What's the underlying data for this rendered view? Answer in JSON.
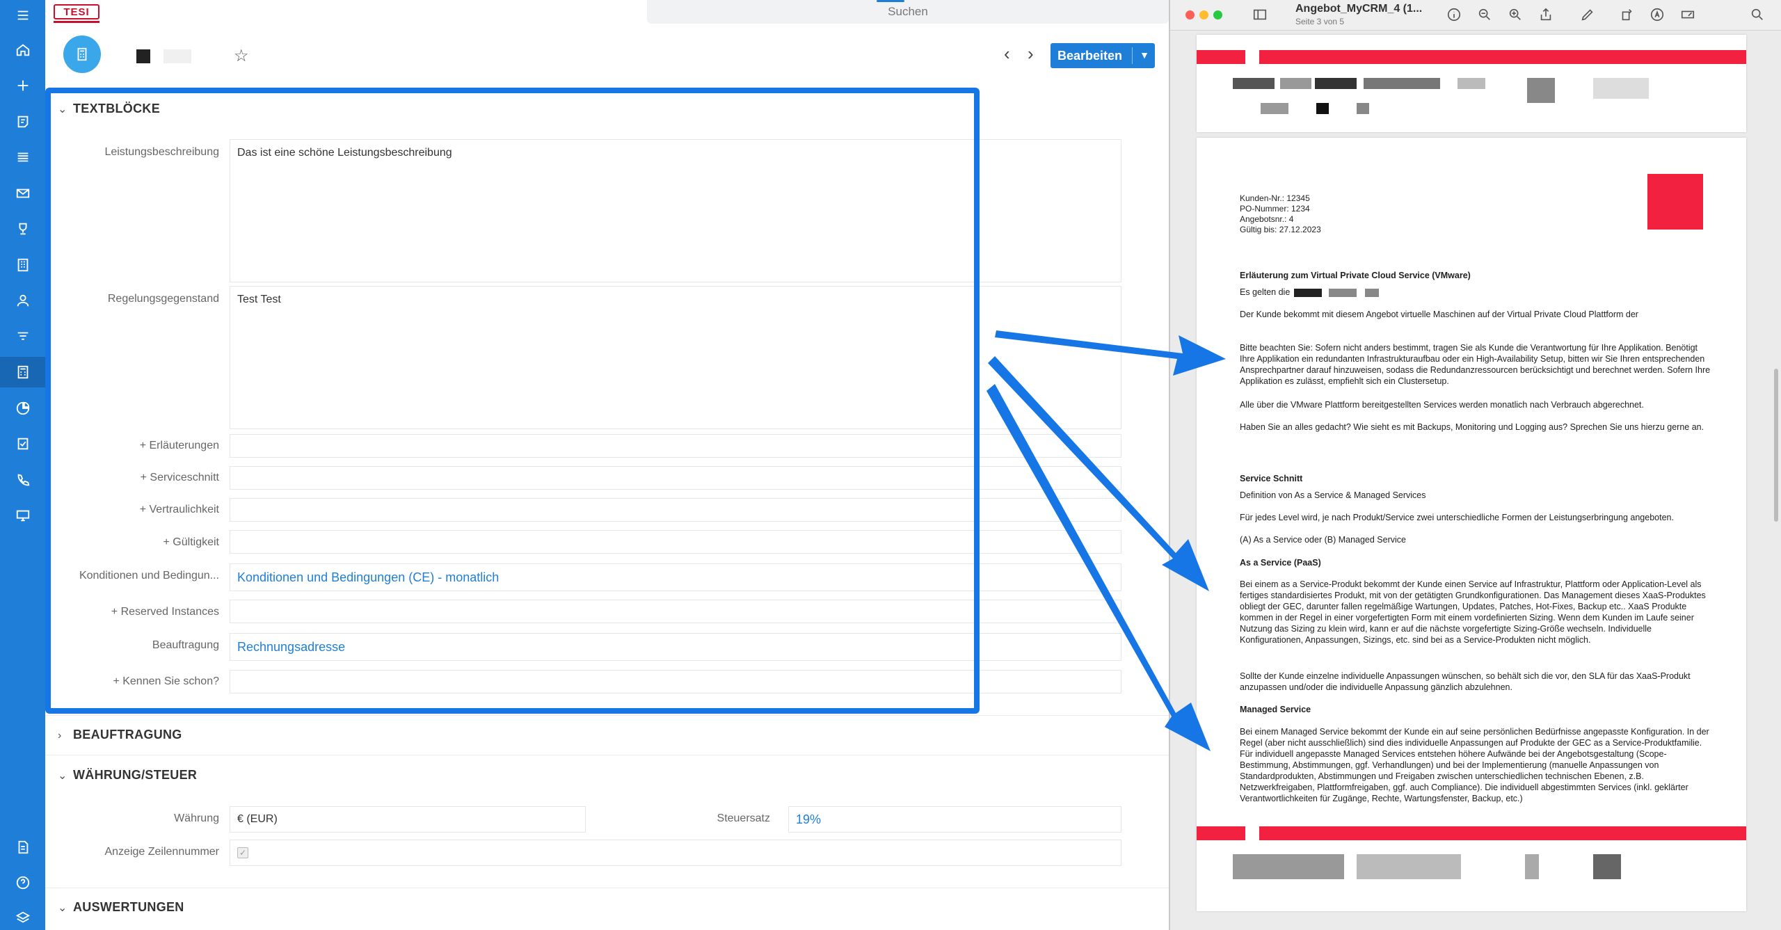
{
  "topbar": {
    "logo_text": "TESI",
    "search_placeholder": "Suchen"
  },
  "toolbar": {
    "edit_label": "Bearbeiten",
    "prev": "‹",
    "next": "›"
  },
  "sections": {
    "textbloecke": "TEXTBLÖCKE",
    "beauftragung": "BEAUFTRAGUNG",
    "waehrung": "WÄHRUNG/STEUER",
    "auswertungen": "AUSWERTUNGEN"
  },
  "fields": {
    "leistung_label": "Leistungsbeschreibung",
    "leistung_value": "Das ist eine schöne Leistungsbeschreibung",
    "regelung_label": "Regelungsgegenstand",
    "regelung_value": "Test Test",
    "erlaeuterungen_label": "+ Erläuterungen",
    "serviceschnitt_label": "+ Serviceschnitt",
    "vertraulichkeit_label": "+ Vertraulichkeit",
    "gueltigkeit_label": "+ Gültigkeit",
    "konditionen_label": "Konditionen und Bedingun...",
    "konditionen_value": "Konditionen und Bedingungen (CE) - monatlich",
    "reserved_label": "+ Reserved Instances",
    "beauftragung_label": "Beauftragung",
    "beauftragung_value": "Rechnungsadresse",
    "kennen_label": "+ Kennen Sie schon?",
    "waehrung_label": "Währung",
    "waehrung_value": "€ (EUR)",
    "steuersatz_label": "Steuersatz",
    "steuersatz_value": "19%",
    "zeilennummer_label": "Anzeige Zeilennummer"
  },
  "preview": {
    "title": "Angebot_MyCRM_4 (1...",
    "subtitle": "Seite 3 von 5",
    "meta": [
      "Kunden-Nr.: 12345",
      "PO-Nummer: 1234",
      "Angebotsnr.: 4",
      "Gültig bis: 27.12.2023"
    ],
    "heading1": "Erläuterung zum Virtual Private Cloud Service (VMware)",
    "line_es_gelten": "Es gelten die",
    "p1": "Der Kunde bekommt mit diesem Angebot virtuelle Maschinen auf der Virtual Private Cloud Plattform der",
    "p2": "Bitte beachten Sie: Sofern nicht anders bestimmt, tragen Sie als Kunde die Verantwortung für Ihre Applikation. Benötigt Ihre Applikation ein redundanten Infrastrukturaufbau oder ein High-Availability Setup, bitten wir Sie Ihren entsprechenden Ansprechpartner darauf hinzuweisen, sodass die Redundanzressourcen berücksichtigt und berechnet werden. Sofern Ihre Applikation es zulässt, empfiehlt sich ein Clustersetup.",
    "p3": "Alle über die VMware Plattform bereitgestellten Services werden monatlich nach Verbrauch abgerechnet.",
    "p4": "Haben Sie an alles gedacht? Wie sieht es mit Backups, Monitoring und Logging aus? Sprechen Sie uns hierzu gerne an.",
    "heading2": "Service Schnitt",
    "p5": "Definition von As a Service & Managed Services",
    "p6": "Für jedes Level wird, je nach Produkt/Service zwei unterschiedliche Formen der Leistungserbringung angeboten.",
    "p7": "(A) As a Service oder (B) Managed Service",
    "heading3": "As a Service (PaaS)",
    "p8": "Bei einem as a Service-Produkt bekommt der Kunde einen Service auf Infrastruktur, Plattform oder Application-Level als fertiges standardisiertes Produkt, mit von der getätigten Grundkonfigurationen. Das Management dieses XaaS-Produktes obliegt der GEC, darunter fallen regelmäßige Wartungen, Updates, Patches, Hot-Fixes, Backup etc.. XaaS Produkte kommen in der Regel in einer vorgefertigten Form mit einem vordefinierten Sizing. Wenn dem Kunden im Laufe seiner Nutzung das Sizing zu klein wird, kann er auf die nächste vorgefertigte Sizing-Größe wechseln. Individuelle Konfigurationen, Anpassungen, Sizings, etc. sind bei as a Service-Produkten nicht möglich.",
    "p9": "Sollte der Kunde einzelne individuelle Anpassungen wünschen, so behält sich die vor, den SLA für das XaaS-Produkt anzupassen und/oder die individuelle Anpassung gänzlich abzulehnen.",
    "heading4": "Managed Service",
    "p10": "Bei einem Managed Service bekommt der Kunde ein auf seine persönlichen Bedürfnisse angepasste Konfiguration. In der Regel (aber nicht ausschließlich) sind dies individuelle Anpassungen auf Produkte der GEC as a Service-Produktfamilie. Für individuell angepasste Managed Services entstehen höhere Aufwände bei der Angebotsgestaltung (Scope-Bestimmung, Abstimmungen, ggf. Verhandlungen) und bei der Implementierung (manuelle Anpassungen von Standardprodukten, Abstimmungen und Freigaben zwischen unterschiedlichen technischen Ebenen, z.B. Netzwerkfreigaben, Plattformfreigaben, ggf. auch Compliance). Die individuell abgestimmten Services (inkl. geklärter Verantwortlichkeiten für Zugänge, Rechte, Wartungsfenster, Backup, etc.)"
  },
  "colors": {
    "brand": "#1f7fd8",
    "highlight": "#1776e6",
    "pdf_red": "#f2213f"
  },
  "icons": [
    "menu-icon",
    "home-icon",
    "plus-icon",
    "note-icon",
    "list-icon",
    "mail-icon",
    "trophy-icon",
    "building-icon",
    "contact-icon",
    "filter-icon",
    "calculator-icon",
    "chart-icon",
    "task-icon",
    "phone-icon",
    "monitor-icon",
    "document-icon",
    "help-icon",
    "layers-icon"
  ]
}
